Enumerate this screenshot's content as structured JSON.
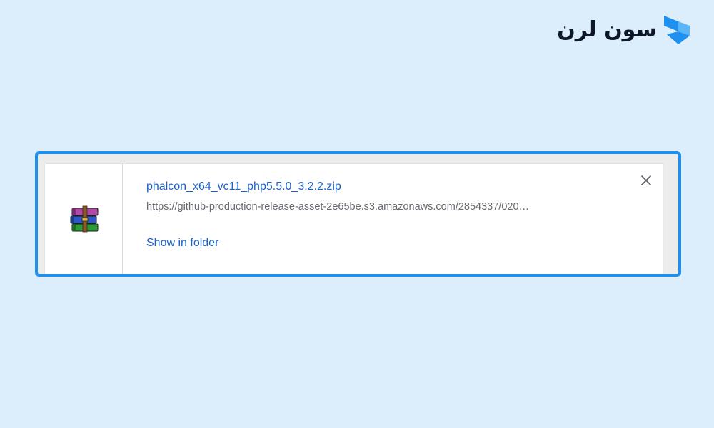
{
  "brand": {
    "name": "سون لرن",
    "icon": "brand-mark-icon",
    "accent_color": "#1e90f0"
  },
  "download_item": {
    "file_name": "phalcon_x64_vc11_php5.5.0_3.2.2.zip",
    "source_url": "https://github-production-release-asset-2e65be.s3.amazonaws.com/2854337/020…",
    "action_label": "Show in folder",
    "file_icon": "winrar-archive-icon",
    "close_icon": "close-icon",
    "link_color": "#1a62c9",
    "highlight_color": "#1e90f0"
  }
}
